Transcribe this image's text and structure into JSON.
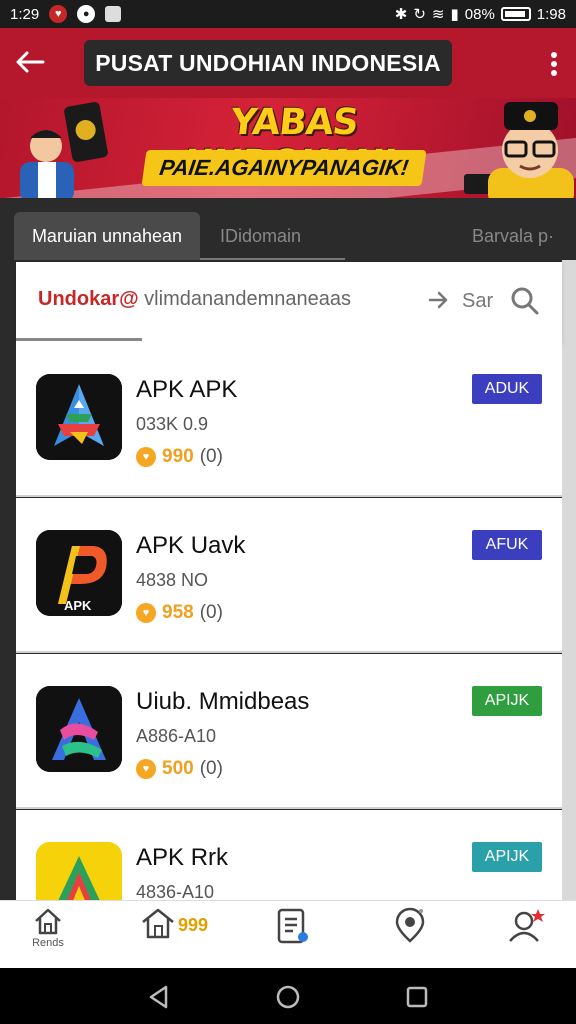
{
  "status_bar": {
    "time": "1:29",
    "right_text": "08%",
    "right_time": "1:98"
  },
  "app_bar": {
    "title": "PUSAT UNDOHIAN INDONESIA"
  },
  "banner": {
    "title": "YABAS UNDOKANI",
    "subtitle": "PAIE.AGAINYPANAGIK!"
  },
  "tabs": [
    {
      "label": "Maruian unnahean"
    },
    {
      "label": "IDidomain"
    },
    {
      "label": "Barvala p·"
    }
  ],
  "search": {
    "prefix": "Undokar@",
    "query": " vlimdanandemnaneaas",
    "action_label": "Sar"
  },
  "apps": [
    {
      "name": "APK APK",
      "meta": "033K 0.9",
      "rating_value": "990",
      "rating_count": "(0)",
      "badge": "ADUK",
      "badge_color": "#3b3fbf"
    },
    {
      "name": "APK Uavk",
      "meta": "4838 NO",
      "rating_value": "958",
      "rating_count": "(0)",
      "badge": "AFUK",
      "badge_color": "#3b3fbf"
    },
    {
      "name": "Uiub. Mmidbeas",
      "meta": "A886-A10",
      "rating_value": "500",
      "rating_count": "(0)",
      "badge": "APIJK",
      "badge_color": "#2e9e3f"
    },
    {
      "name": "APK Rrk",
      "meta": "4836-A10",
      "rating_value": "",
      "rating_count": "",
      "badge": "APIJK",
      "badge_color": "#2aa0a8"
    }
  ],
  "bottom_nav": {
    "items": [
      {
        "label": "Rends",
        "icon": "home-icon"
      },
      {
        "label": "",
        "icon": "home-icon",
        "badge": "999"
      },
      {
        "label": "",
        "icon": "document-icon"
      },
      {
        "label": "",
        "icon": "location-icon"
      },
      {
        "label": "",
        "icon": "profile-icon"
      }
    ]
  },
  "icon_apk_label": "APK"
}
